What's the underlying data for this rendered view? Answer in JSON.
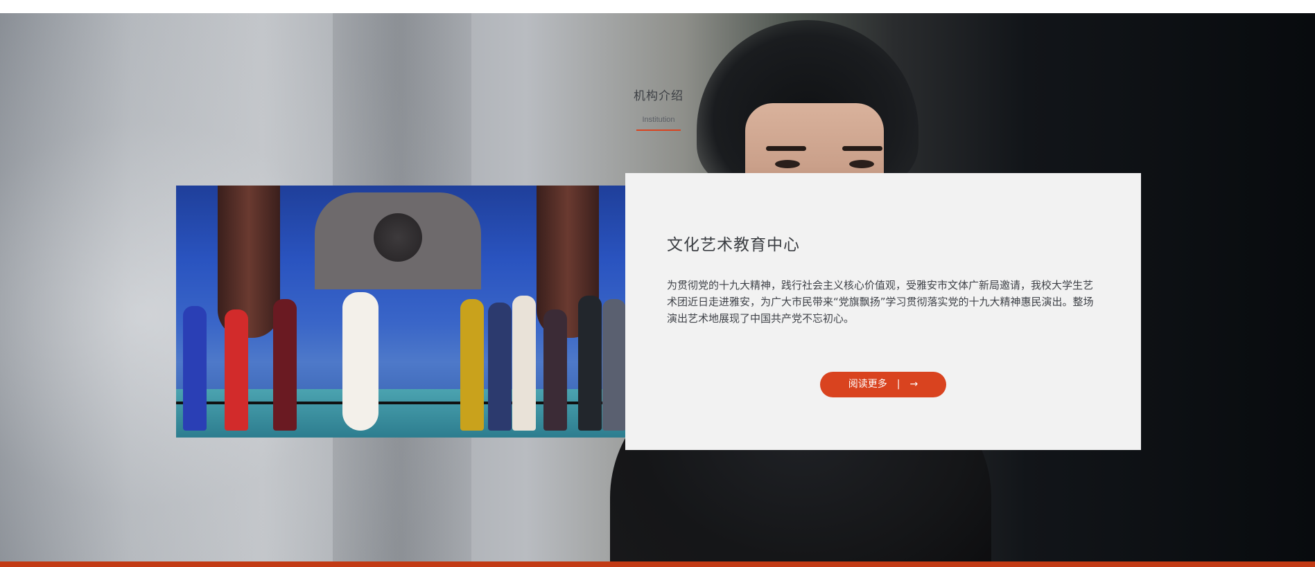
{
  "section": {
    "title": "机构介绍",
    "subtitle": "Institution"
  },
  "card": {
    "title": "文化艺术教育中心",
    "body": "为贯彻党的十九大精神，践行社会主义核心价值观，受雅安市文体广新局邀请，我校大学生艺术团近日走进雅安，为广大市民带来“党旗飘扬”学习贯彻落实党的十九大精神惠民演出。整场演出艺术地展现了中国共产党不忘初心。",
    "button": {
      "label": "阅读更多",
      "separator": "|",
      "arrow": "→"
    }
  },
  "colors": {
    "accent": "#d9431f",
    "footer": "#c23a14",
    "card_bg": "#f2f2f2"
  },
  "images": {
    "hero_background": "portrait-background",
    "stage_photo": "stage-performance-photo"
  }
}
